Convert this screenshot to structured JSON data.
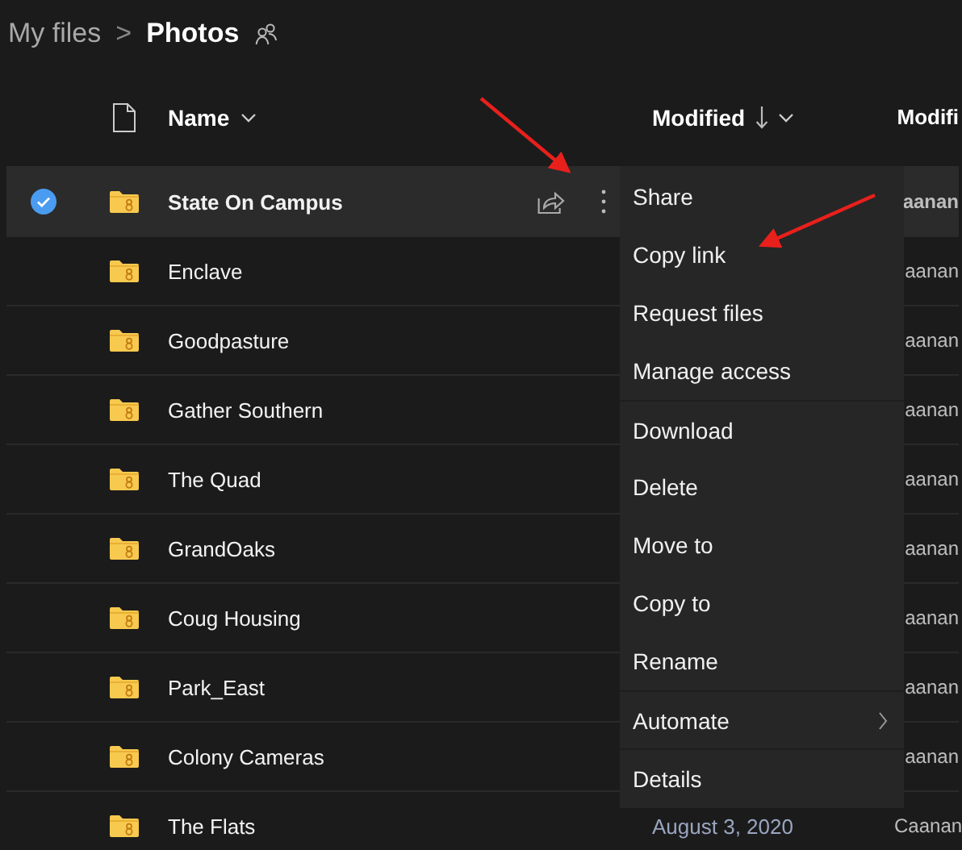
{
  "breadcrumb": {
    "parent": "My files",
    "separator": ">",
    "current": "Photos"
  },
  "columns": {
    "name": "Name",
    "modified": "Modified",
    "modified_by": "Modifi"
  },
  "rows": [
    {
      "name": "State On Campus",
      "selected": true,
      "modified_by": "aanan"
    },
    {
      "name": "Enclave",
      "selected": false,
      "modified_by": "aanan"
    },
    {
      "name": "Goodpasture",
      "selected": false,
      "modified_by": "aanan"
    },
    {
      "name": "Gather Southern",
      "selected": false,
      "modified_by": "aanan"
    },
    {
      "name": "The Quad",
      "selected": false,
      "modified_by": "aanan"
    },
    {
      "name": "GrandOaks",
      "selected": false,
      "modified_by": "aanan"
    },
    {
      "name": "Coug Housing",
      "selected": false,
      "modified_by": "aanan"
    },
    {
      "name": "Park_East",
      "selected": false,
      "modified_by": "aanan"
    },
    {
      "name": "Colony Cameras",
      "selected": false,
      "modified_by": "aanan"
    },
    {
      "name": "The Flats",
      "selected": false,
      "modified": "August 3, 2020",
      "modified_by": "Caanan"
    }
  ],
  "context_menu": [
    {
      "label": "Share",
      "divider_before": false,
      "has_submenu": false
    },
    {
      "label": "Copy link",
      "divider_before": false,
      "has_submenu": false
    },
    {
      "label": "Request files",
      "divider_before": false,
      "has_submenu": false
    },
    {
      "label": "Manage access",
      "divider_before": false,
      "has_submenu": false
    },
    {
      "label": "Download",
      "divider_before": true,
      "has_submenu": false
    },
    {
      "label": "Delete",
      "divider_before": false,
      "has_submenu": false
    },
    {
      "label": "Move to",
      "divider_before": false,
      "has_submenu": false
    },
    {
      "label": "Copy to",
      "divider_before": false,
      "has_submenu": false
    },
    {
      "label": "Rename",
      "divider_before": false,
      "has_submenu": false
    },
    {
      "label": "Automate",
      "divider_before": true,
      "has_submenu": true
    },
    {
      "label": "Details",
      "divider_before": true,
      "has_submenu": false
    }
  ]
}
